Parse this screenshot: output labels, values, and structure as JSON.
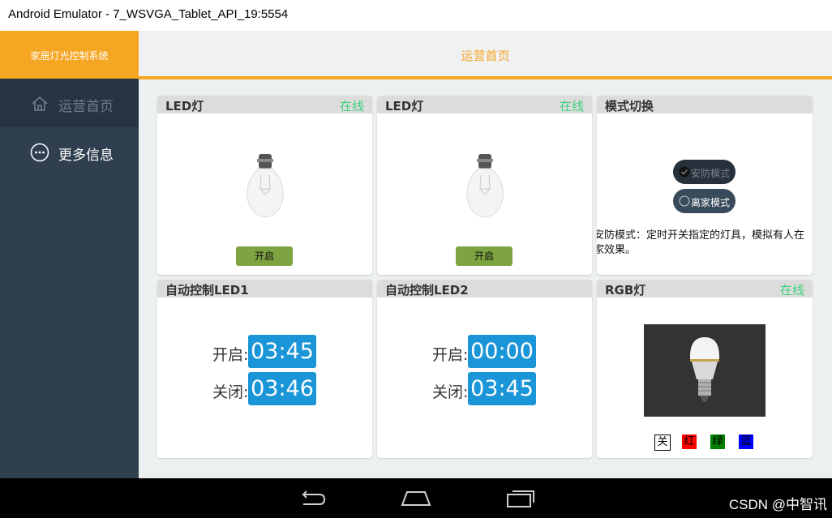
{
  "window": {
    "title": "Android Emulator - 7_WSVGA_Tablet_API_19:5554"
  },
  "app": {
    "brand": "家居灯光控制系统",
    "header_title": "运营首页"
  },
  "sidebar": {
    "items": [
      {
        "label": "运营首页",
        "icon": "home-icon",
        "active": true
      },
      {
        "label": "更多信息",
        "icon": "more-icon",
        "active": false
      }
    ]
  },
  "cards": {
    "led1": {
      "title": "LED灯",
      "status": "在线",
      "button": "开启"
    },
    "led2": {
      "title": "LED灯",
      "status": "在线",
      "button": "开启"
    },
    "mode": {
      "title": "模式切换",
      "option1": "安防模式",
      "option2": "离家模式",
      "description": "安防模式：定时开关指定的灯具，模拟有人在家效果。"
    },
    "auto1": {
      "title": "自动控制LED1",
      "on_label": "开启:",
      "on_time": "03:45",
      "off_label": "关闭:",
      "off_time": "03:46"
    },
    "auto2": {
      "title": "自动控制LED2",
      "on_label": "开启:",
      "on_time": "00:00",
      "off_label": "关闭:",
      "off_time": "03:45"
    },
    "rgb": {
      "title": "RGB灯",
      "status": "在线",
      "controls": [
        "关",
        "红",
        "绿",
        "蓝"
      ]
    }
  },
  "colors": {
    "accent": "#f5a623",
    "online": "#3ed17a",
    "time_bg": "#1a95d8",
    "button_green": "#7ea341",
    "sidebar": "#2f3f50"
  },
  "watermark": "CSDN @中智讯"
}
